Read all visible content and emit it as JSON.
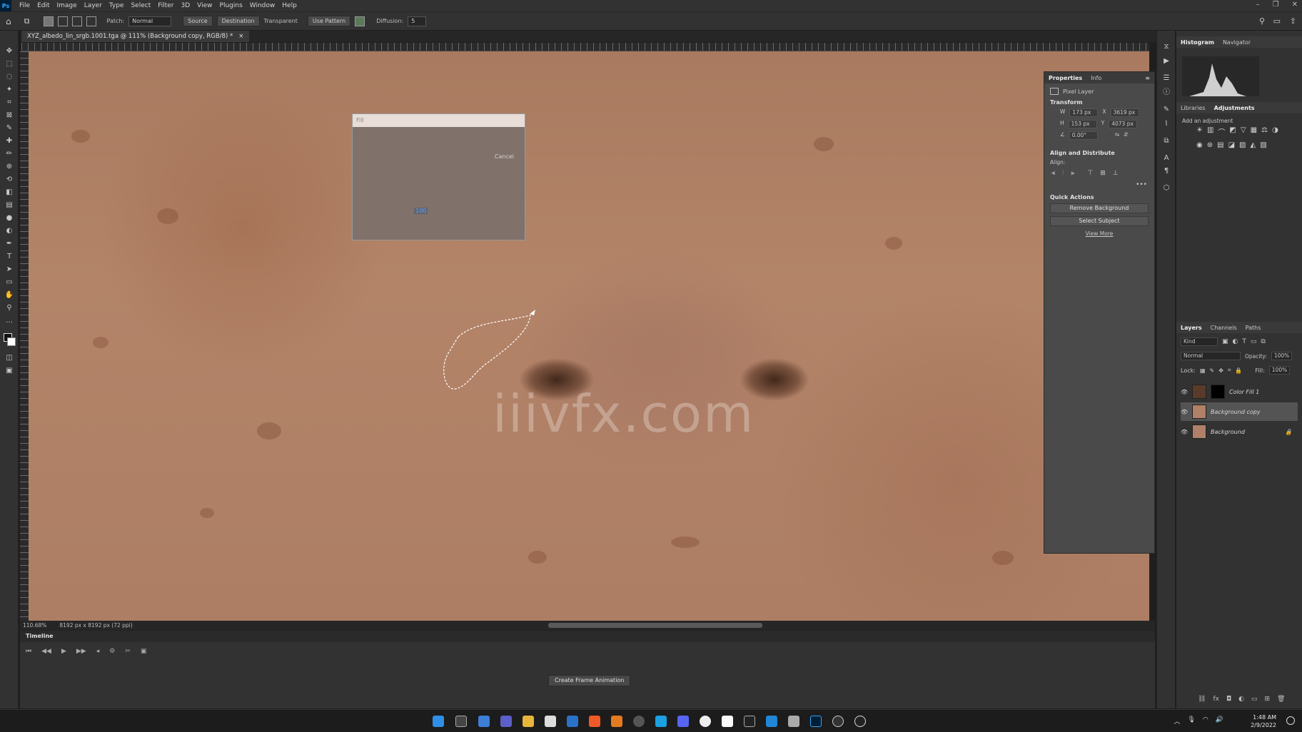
{
  "menubar": {
    "app_icon": "Ps",
    "items": [
      "File",
      "Edit",
      "Image",
      "Layer",
      "Type",
      "Select",
      "Filter",
      "3D",
      "View",
      "Plugins",
      "Window",
      "Help"
    ]
  },
  "options": {
    "patch_label": "Patch:",
    "patch_mode": "Normal",
    "source_label": "Source",
    "destination_label": "Destination",
    "transparent_label": "Transparent",
    "use_pattern_label": "Use Pattern",
    "diffusion_label": "Diffusion:",
    "diffusion_value": "5"
  },
  "document": {
    "tab_title": "XYZ_albedo_lin_srgb.1001.tga @ 111% (Background copy, RGB/8) *",
    "close_glyph": "×"
  },
  "fill_dialog": {
    "title": "Fill",
    "cancel_label": "Cancel",
    "value": "100"
  },
  "watermark": "iiivfx.com",
  "properties": {
    "tab_properties": "Properties",
    "tab_info": "Info",
    "layer_type": "Pixel Layer",
    "transform_title": "Transform",
    "w_label": "W",
    "w_value": "173 px",
    "x_label": "X",
    "x_value": "3619 px",
    "h_label": "H",
    "h_value": "153 px",
    "y_label": "Y",
    "y_value": "4073 px",
    "angle_value": "0.00°",
    "align_title": "Align and Distribute",
    "align_label": "Align:",
    "quick_actions_title": "Quick Actions",
    "remove_bg_label": "Remove Background",
    "select_subject_label": "Select Subject",
    "view_more_label": "View More"
  },
  "right": {
    "tab_histogram": "Histogram",
    "tab_navigator": "Navigator",
    "tab_libraries": "Libraries",
    "tab_adjustments": "Adjustments",
    "add_adjustment_label": "Add an adjustment",
    "tab_layers": "Layers",
    "tab_channels": "Channels",
    "tab_paths": "Paths",
    "kind_label": "Kind",
    "blend_mode": "Normal",
    "opacity_label": "Opacity:",
    "opacity_value": "100%",
    "lock_label": "Lock:",
    "fill_label": "Fill:",
    "fill_value": "100%",
    "layers": [
      {
        "name": "Color Fill 1"
      },
      {
        "name": "Background copy"
      },
      {
        "name": "Background"
      }
    ]
  },
  "status": {
    "zoom": "110.68%",
    "doc_size": "8192 px x 8192 px (72 ppi)"
  },
  "timeline": {
    "title": "Timeline",
    "create_label": "Create Frame Animation"
  },
  "taskbar": {
    "time": "1:48 AM",
    "date": "2/9/2022"
  },
  "colors": {
    "accent": "#31a8ff",
    "skin": "#ad7e64",
    "panel": "#323232"
  }
}
